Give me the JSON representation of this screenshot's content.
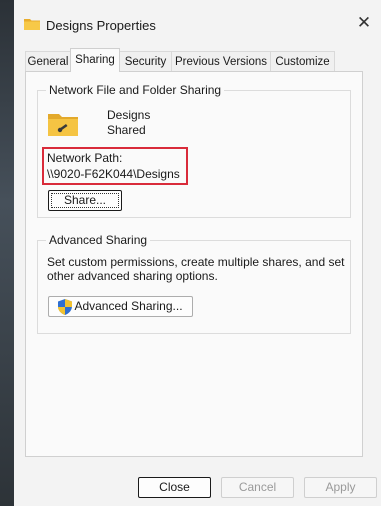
{
  "window": {
    "title": "Designs Properties",
    "close_glyph": "✕"
  },
  "tabs": [
    {
      "label": "General"
    },
    {
      "label": "Sharing"
    },
    {
      "label": "Security"
    },
    {
      "label": "Previous Versions"
    },
    {
      "label": "Customize"
    }
  ],
  "active_tab": "Sharing",
  "network_sharing": {
    "group_title": "Network File and Folder Sharing",
    "folder_name": "Designs",
    "status": "Shared",
    "network_path_label": "Network Path:",
    "network_path_value": "\\\\9020-F62K044\\Designs",
    "share_button": "Share..."
  },
  "advanced_sharing": {
    "group_title": "Advanced Sharing",
    "description": "Set custom permissions, create multiple shares, and set other advanced sharing options.",
    "button": "Advanced Sharing..."
  },
  "footer": {
    "close": "Close",
    "cancel": "Cancel",
    "apply": "Apply"
  },
  "colors": {
    "highlight": "#d92b3a",
    "folder": "#f2c14e"
  }
}
